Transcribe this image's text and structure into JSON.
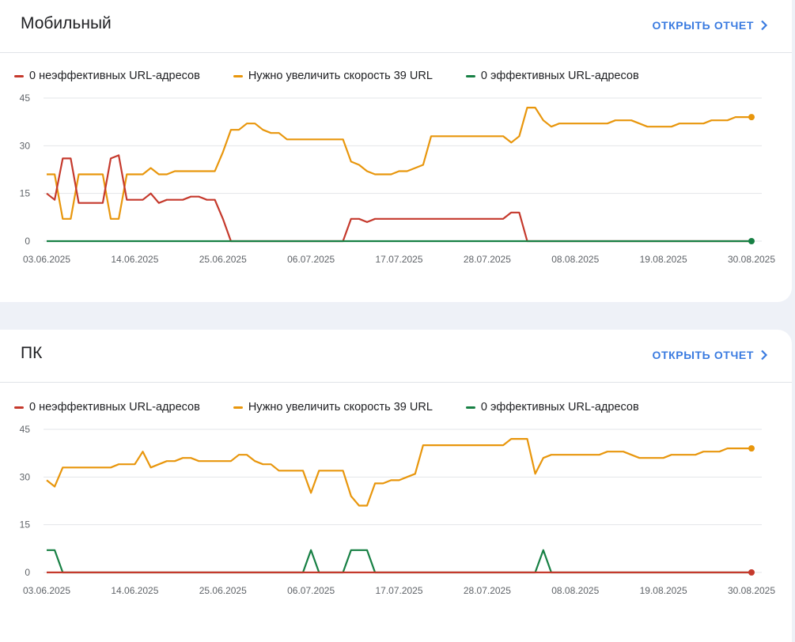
{
  "colors": {
    "poor": "#c5392c",
    "needs_improvement": "#e8960c",
    "good": "#178044",
    "accent": "#3a7be0"
  },
  "cards": [
    {
      "title": "Мобильный",
      "open_report": "ОТКРЫТЬ ОТЧЕТ",
      "legend": [
        {
          "label": "0 неэффективных URL-адресов",
          "color": "#c5392c"
        },
        {
          "label": "Нужно увеличить скорость 39 URL",
          "color": "#e8960c"
        },
        {
          "label": "0 эффективных URL-адресов",
          "color": "#178044"
        }
      ]
    },
    {
      "title": "ПК",
      "open_report": "ОТКРЫТЬ ОТЧЕТ",
      "legend": [
        {
          "label": "0 неэффективных URL-адресов",
          "color": "#c5392c"
        },
        {
          "label": "Нужно увеличить скорость 39 URL",
          "color": "#e8960c"
        },
        {
          "label": "0 эффективных URL-адресов",
          "color": "#178044"
        }
      ]
    }
  ],
  "chart_data": [
    {
      "type": "line",
      "ylim": [
        0,
        45
      ],
      "yticks": [
        "0",
        "15",
        "30",
        "45"
      ],
      "grid": true,
      "legend_position": "top-left",
      "xlim": [
        "03.06.2025",
        "30.08.2025"
      ],
      "xticks": [
        "03.06.2025",
        "14.06.2025",
        "25.06.2025",
        "06.07.2025",
        "17.07.2025",
        "28.07.2025",
        "08.08.2025",
        "19.08.2025",
        "30.08.2025"
      ],
      "series": [
        {
          "name": "Нужно увеличить скорость 39 URL",
          "color": "#e8960c",
          "x": [
            "03.06.2025",
            "04.06.2025",
            "05.06.2025",
            "06.06.2025",
            "07.06.2025",
            "08.06.2025",
            "09.06.2025",
            "10.06.2025",
            "11.06.2025",
            "12.06.2025",
            "13.06.2025",
            "14.06.2025",
            "15.06.2025",
            "16.06.2025",
            "17.06.2025",
            "18.06.2025",
            "19.06.2025",
            "20.06.2025",
            "21.06.2025",
            "22.06.2025",
            "23.06.2025",
            "24.06.2025",
            "25.06.2025",
            "26.06.2025",
            "27.06.2025",
            "28.06.2025",
            "29.06.2025",
            "30.06.2025",
            "01.07.2025",
            "02.07.2025",
            "03.07.2025",
            "04.07.2025",
            "05.07.2025",
            "06.07.2025",
            "07.07.2025",
            "08.07.2025",
            "09.07.2025",
            "10.07.2025",
            "11.07.2025",
            "12.07.2025",
            "13.07.2025",
            "14.07.2025",
            "15.07.2025",
            "16.07.2025",
            "17.07.2025",
            "18.07.2025",
            "19.07.2025",
            "20.07.2025",
            "21.07.2025",
            "22.07.2025",
            "23.07.2025",
            "24.07.2025",
            "25.07.2025",
            "26.07.2025",
            "27.07.2025",
            "28.07.2025",
            "29.07.2025",
            "30.07.2025",
            "31.07.2025",
            "01.08.2025",
            "02.08.2025",
            "03.08.2025",
            "04.08.2025",
            "05.08.2025",
            "06.08.2025",
            "07.08.2025",
            "08.08.2025",
            "09.08.2025",
            "10.08.2025",
            "11.08.2025",
            "12.08.2025",
            "13.08.2025",
            "14.08.2025",
            "15.08.2025",
            "16.08.2025",
            "17.08.2025",
            "18.08.2025",
            "19.08.2025",
            "20.08.2025",
            "21.08.2025",
            "22.08.2025",
            "23.08.2025",
            "24.08.2025",
            "25.08.2025",
            "26.08.2025",
            "27.08.2025",
            "28.08.2025",
            "29.08.2025",
            "30.08.2025"
          ],
          "values": [
            21,
            21,
            7,
            7,
            21,
            21,
            21,
            21,
            7,
            7,
            21,
            21,
            21,
            23,
            21,
            21,
            22,
            22,
            22,
            22,
            22,
            22,
            28,
            35,
            35,
            37,
            37,
            35,
            34,
            34,
            32,
            32,
            32,
            32,
            32,
            32,
            32,
            32,
            25,
            24,
            22,
            21,
            21,
            21,
            22,
            22,
            23,
            24,
            33,
            33,
            33,
            33,
            33,
            33,
            33,
            33,
            33,
            33,
            31,
            33,
            42,
            42,
            38,
            36,
            37,
            37,
            37,
            37,
            37,
            37,
            37,
            38,
            38,
            38,
            37,
            36,
            36,
            36,
            36,
            37,
            37,
            37,
            37,
            38,
            38,
            38,
            39,
            39,
            39
          ]
        },
        {
          "name": "0 неэффективных URL-адресов",
          "color": "#c5392c",
          "x": [
            "03.06.2025",
            "04.06.2025",
            "05.06.2025",
            "06.06.2025",
            "07.06.2025",
            "08.06.2025",
            "09.06.2025",
            "10.06.2025",
            "11.06.2025",
            "12.06.2025",
            "13.06.2025",
            "14.06.2025",
            "15.06.2025",
            "16.06.2025",
            "17.06.2025",
            "18.06.2025",
            "19.06.2025",
            "20.06.2025",
            "21.06.2025",
            "22.06.2025",
            "23.06.2025",
            "24.06.2025",
            "25.06.2025",
            "26.06.2025",
            "27.06.2025",
            "28.06.2025",
            "29.06.2025",
            "30.06.2025",
            "01.07.2025",
            "02.07.2025",
            "03.07.2025",
            "04.07.2025",
            "05.07.2025",
            "06.07.2025",
            "07.07.2025",
            "08.07.2025",
            "09.07.2025",
            "10.07.2025",
            "11.07.2025",
            "12.07.2025",
            "13.07.2025",
            "14.07.2025",
            "15.07.2025",
            "16.07.2025",
            "17.07.2025",
            "18.07.2025",
            "19.07.2025",
            "20.07.2025",
            "21.07.2025",
            "22.07.2025",
            "23.07.2025",
            "24.07.2025",
            "25.07.2025",
            "26.07.2025",
            "27.07.2025",
            "28.07.2025",
            "29.07.2025",
            "30.07.2025",
            "31.07.2025",
            "01.08.2025",
            "02.08.2025",
            "03.08.2025",
            "04.08.2025",
            "05.08.2025",
            "06.08.2025",
            "07.08.2025",
            "08.08.2025",
            "09.08.2025",
            "10.08.2025",
            "11.08.2025",
            "12.08.2025",
            "13.08.2025",
            "14.08.2025",
            "15.08.2025",
            "16.08.2025",
            "17.08.2025",
            "18.08.2025",
            "19.08.2025",
            "20.08.2025",
            "21.08.2025",
            "22.08.2025",
            "23.08.2025",
            "24.08.2025",
            "25.08.2025",
            "26.08.2025",
            "27.08.2025",
            "28.08.2025",
            "29.08.2025",
            "30.08.2025"
          ],
          "values": [
            15,
            13,
            26,
            26,
            12,
            12,
            12,
            12,
            26,
            27,
            13,
            13,
            13,
            15,
            12,
            13,
            13,
            13,
            14,
            14,
            13,
            13,
            7,
            0,
            0,
            0,
            0,
            0,
            0,
            0,
            0,
            0,
            0,
            0,
            0,
            0,
            0,
            0,
            7,
            7,
            6,
            7,
            7,
            7,
            7,
            7,
            7,
            7,
            7,
            7,
            7,
            7,
            7,
            7,
            7,
            7,
            7,
            7,
            9,
            9,
            0,
            0,
            0,
            0,
            0,
            0,
            0,
            0,
            0,
            0,
            0,
            0,
            0,
            0,
            0,
            0,
            0,
            0,
            0,
            0,
            0,
            0,
            0,
            0,
            0,
            0,
            0,
            0,
            0
          ]
        },
        {
          "name": "0 эффективных URL-адресов",
          "color": "#178044",
          "x": [
            "03.06.2025",
            "30.08.2025"
          ],
          "values": [
            0,
            0
          ]
        }
      ]
    },
    {
      "type": "line",
      "ylim": [
        0,
        45
      ],
      "yticks": [
        "0",
        "15",
        "30",
        "45"
      ],
      "grid": true,
      "legend_position": "top-left",
      "xlim": [
        "03.06.2025",
        "30.08.2025"
      ],
      "xticks": [
        "03.06.2025",
        "14.06.2025",
        "25.06.2025",
        "06.07.2025",
        "17.07.2025",
        "28.07.2025",
        "08.08.2025",
        "19.08.2025",
        "30.08.2025"
      ],
      "series": [
        {
          "name": "Нужно увеличить скорость 39 URL",
          "color": "#e8960c",
          "x": [
            "03.06.2025",
            "04.06.2025",
            "05.06.2025",
            "06.06.2025",
            "07.06.2025",
            "08.06.2025",
            "09.06.2025",
            "10.06.2025",
            "11.06.2025",
            "12.06.2025",
            "13.06.2025",
            "14.06.2025",
            "15.06.2025",
            "16.06.2025",
            "17.06.2025",
            "18.06.2025",
            "19.06.2025",
            "20.06.2025",
            "21.06.2025",
            "22.06.2025",
            "23.06.2025",
            "24.06.2025",
            "25.06.2025",
            "26.06.2025",
            "27.06.2025",
            "28.06.2025",
            "29.06.2025",
            "30.06.2025",
            "01.07.2025",
            "02.07.2025",
            "03.07.2025",
            "04.07.2025",
            "05.07.2025",
            "06.07.2025",
            "07.07.2025",
            "08.07.2025",
            "09.07.2025",
            "10.07.2025",
            "11.07.2025",
            "12.07.2025",
            "13.07.2025",
            "14.07.2025",
            "15.07.2025",
            "16.07.2025",
            "17.07.2025",
            "18.07.2025",
            "19.07.2025",
            "20.07.2025",
            "21.07.2025",
            "22.07.2025",
            "23.07.2025",
            "24.07.2025",
            "25.07.2025",
            "26.07.2025",
            "27.07.2025",
            "28.07.2025",
            "29.07.2025",
            "30.07.2025",
            "31.07.2025",
            "01.08.2025",
            "02.08.2025",
            "03.08.2025",
            "04.08.2025",
            "05.08.2025",
            "06.08.2025",
            "07.08.2025",
            "08.08.2025",
            "09.08.2025",
            "10.08.2025",
            "11.08.2025",
            "12.08.2025",
            "13.08.2025",
            "14.08.2025",
            "15.08.2025",
            "16.08.2025",
            "17.08.2025",
            "18.08.2025",
            "19.08.2025",
            "20.08.2025",
            "21.08.2025",
            "22.08.2025",
            "23.08.2025",
            "24.08.2025",
            "25.08.2025",
            "26.08.2025",
            "27.08.2025",
            "28.08.2025",
            "29.08.2025",
            "30.08.2025"
          ],
          "values": [
            29,
            27,
            33,
            33,
            33,
            33,
            33,
            33,
            33,
            34,
            34,
            34,
            38,
            33,
            34,
            35,
            35,
            36,
            36,
            35,
            35,
            35,
            35,
            35,
            37,
            37,
            35,
            34,
            34,
            32,
            32,
            32,
            32,
            25,
            32,
            32,
            32,
            32,
            24,
            21,
            21,
            28,
            28,
            29,
            29,
            30,
            31,
            40,
            40,
            40,
            40,
            40,
            40,
            40,
            40,
            40,
            40,
            40,
            42,
            42,
            42,
            31,
            36,
            37,
            37,
            37,
            37,
            37,
            37,
            37,
            38,
            38,
            38,
            37,
            36,
            36,
            36,
            36,
            37,
            37,
            37,
            37,
            38,
            38,
            38,
            39,
            39,
            39,
            39
          ]
        },
        {
          "name": "0 эффективных URL-адресов",
          "color": "#178044",
          "x": [
            "03.06.2025",
            "04.06.2025",
            "05.06.2025",
            "06.06.2025",
            "05.07.2025",
            "06.07.2025",
            "07.07.2025",
            "09.07.2025",
            "10.07.2025",
            "11.07.2025",
            "12.07.2025",
            "13.07.2025",
            "14.07.2025",
            "03.08.2025",
            "04.08.2025",
            "05.08.2025",
            "30.08.2025"
          ],
          "values": [
            7,
            7,
            0,
            0,
            0,
            7,
            0,
            0,
            0,
            7,
            7,
            7,
            0,
            0,
            7,
            0,
            0
          ]
        },
        {
          "name": "0 неэффективных URL-адресов",
          "color": "#c5392c",
          "x": [
            "03.06.2025",
            "30.08.2025"
          ],
          "values": [
            0,
            0
          ]
        }
      ]
    }
  ]
}
